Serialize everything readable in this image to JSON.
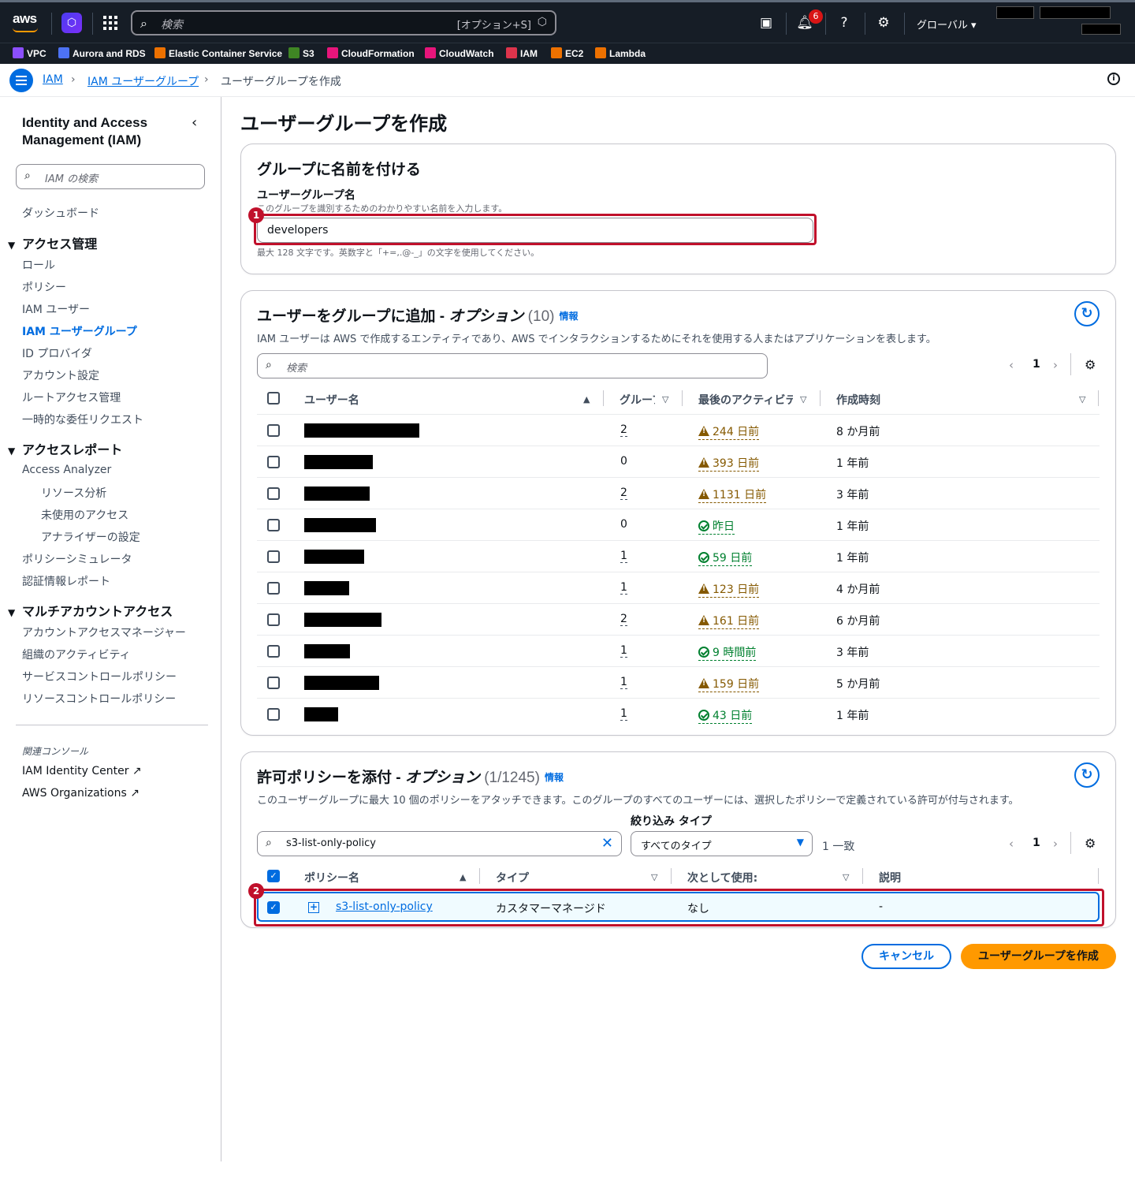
{
  "topbar": {
    "logo": "aws",
    "search_placeholder": "検索",
    "search_shortcut": "[オプション+S]",
    "notification_count": "6",
    "region": "グローバル ▾"
  },
  "favorites": [
    {
      "label": "VPC",
      "color": "#8c4fff"
    },
    {
      "label": "Aurora and RDS",
      "color": "#4d72f3"
    },
    {
      "label": "Elastic Container Service",
      "color": "#ed7100"
    },
    {
      "label": "S3",
      "color": "#3f8624"
    },
    {
      "label": "CloudFormation",
      "color": "#e7157b"
    },
    {
      "label": "CloudWatch",
      "color": "#e7157b"
    },
    {
      "label": "IAM",
      "color": "#dd344c"
    },
    {
      "label": "EC2",
      "color": "#ed7100"
    },
    {
      "label": "Lambda",
      "color": "#ed7100"
    }
  ],
  "breadcrumb": {
    "items": [
      "IAM",
      "IAM ユーザーグループ",
      "ユーザーグループを作成"
    ]
  },
  "sidebar": {
    "title": "Identity and Access Management (IAM)",
    "search_placeholder": "IAM の検索",
    "dashboard": "ダッシュボード",
    "section1": "アクセス管理",
    "section1_items": [
      "ロール",
      "ポリシー",
      "IAM ユーザー",
      "IAM ユーザーグループ",
      "ID プロバイダ",
      "アカウント設定",
      "ルートアクセス管理",
      "一時的な委任リクエスト"
    ],
    "section2": "アクセスレポート",
    "access_analyzer": "Access Analyzer",
    "analyzer_items": [
      "リソース分析",
      "未使用のアクセス",
      "アナライザーの設定"
    ],
    "section2_items": [
      "ポリシーシミュレータ",
      "認証情報レポート"
    ],
    "section3": "マルチアカウントアクセス",
    "section3_items": [
      "アカウントアクセスマネージャー",
      "組織のアクティビティ",
      "サービスコントロールポリシー",
      "リソースコントロールポリシー"
    ],
    "related": "関連コンソール",
    "external": [
      "IAM Identity Center",
      "AWS Organizations"
    ]
  },
  "page": {
    "title": "ユーザーグループを作成"
  },
  "name_card": {
    "heading": "グループに名前を付ける",
    "label": "ユーザーグループ名",
    "description": "このグループを識別するためのわかりやすい名前を入力します。",
    "value": "developers",
    "hint": "最大 128 文字です。英数字と「+=,.@-_」の文字を使用してください。",
    "marker": "1"
  },
  "users_card": {
    "heading": "ユーザーをグループに追加 - ",
    "heading_italic": "オプション",
    "count": "(10)",
    "info": "情報",
    "description": "IAM ユーザーは AWS で作成するエンティティであり、AWS でインタラクションするためにそれを使用する人またはアプリケーションを表します。",
    "search_placeholder": "検索",
    "page": "1",
    "columns": [
      "ユーザー名",
      "グループ",
      "最後のアクティビティ",
      "作成時刻"
    ],
    "rows": [
      {
        "groups": "2",
        "activity": "244 日前",
        "status": "warn",
        "created": "8 か月前"
      },
      {
        "groups": "0",
        "activity": "393 日前",
        "status": "warn",
        "created": "1 年前"
      },
      {
        "groups": "2",
        "activity": "1131 日前",
        "status": "warn",
        "created": "3 年前"
      },
      {
        "groups": "0",
        "activity": "昨日",
        "status": "ok",
        "created": "1 年前"
      },
      {
        "groups": "1",
        "activity": "59 日前",
        "status": "ok",
        "created": "1 年前"
      },
      {
        "groups": "1",
        "activity": "123 日前",
        "status": "warn",
        "created": "4 か月前"
      },
      {
        "groups": "2",
        "activity": "161 日前",
        "status": "warn",
        "created": "6 か月前"
      },
      {
        "groups": "1",
        "activity": "9 時間前",
        "status": "ok",
        "created": "3 年前"
      },
      {
        "groups": "1",
        "activity": "159 日前",
        "status": "warn",
        "created": "5 か月前"
      },
      {
        "groups": "1",
        "activity": "43 日前",
        "status": "ok",
        "created": "1 年前"
      }
    ]
  },
  "policy_card": {
    "heading": "許可ポリシーを添付 - ",
    "heading_italic": "オプション",
    "count": "(1/1245)",
    "info": "情報",
    "description": "このユーザーグループに最大 10 個のポリシーをアタッチできます。このグループのすべてのユーザーには、選択したポリシーで定義されている許可が付与されます。",
    "search_value": "s3-list-only-policy",
    "filter_label": "絞り込み タイプ",
    "filter_value": "すべてのタイプ",
    "match": "1 一致",
    "page": "1",
    "columns": [
      "ポリシー名",
      "タイプ",
      "次として使用:",
      "説明"
    ],
    "row": {
      "name": "s3-list-only-policy",
      "type": "カスタマーマネージド",
      "used_as": "なし",
      "description": "-"
    },
    "marker": "2"
  },
  "actions": {
    "cancel": "キャンセル",
    "create": "ユーザーグループを作成"
  },
  "colors": {
    "accent": "#006ce0",
    "primary_button": "#ff9900",
    "highlight": "#c0102b",
    "warning": "#855900",
    "success": "#00802f"
  }
}
